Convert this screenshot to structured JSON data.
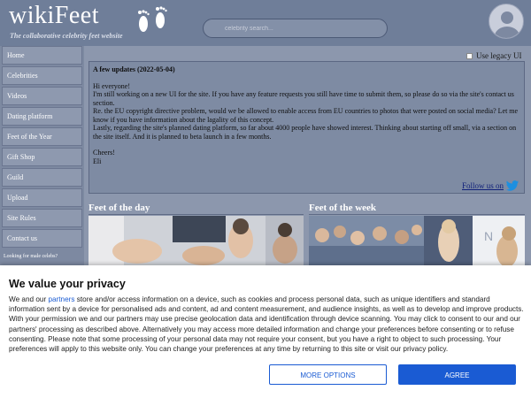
{
  "header": {
    "logo": "wikiFeet",
    "tagline": "The collaborative celebrity feet website",
    "search_placeholder": "celebrity search..."
  },
  "sidebar": {
    "items": [
      {
        "label": "Home"
      },
      {
        "label": "Celebrities"
      },
      {
        "label": "Videos"
      },
      {
        "label": "Dating platform"
      },
      {
        "label": "Feet of the Year"
      },
      {
        "label": "Gift Shop"
      },
      {
        "label": "Guild"
      },
      {
        "label": "Upload"
      },
      {
        "label": "Site Rules"
      },
      {
        "label": "Contact us"
      }
    ],
    "note": "Looking for male celebs?"
  },
  "legacy": {
    "label": "Use legacy UI"
  },
  "updates": {
    "title": "A few updates (2022-05-04)",
    "greeting": "Hi everyone!",
    "p1": "I'm still working on a new UI for the site. If you have any feature requests you still have time to submit them, so please do so via the site's contact us section.",
    "p2": "Re. the EU copyright directive problem, would we be allowed to enable access from EU countries to photos that were posted on social media? Let me know if you have information about the lagality of this concept.",
    "p3": "Lastly, regarding the site's planned dating platform, so far about 4000 people have showed interest. Thinking about starting off small, via a section on the site itself. And it is planned to beta launch in a few months.",
    "signoff": "Cheers!",
    "signature": "Eli",
    "follow": "Follow us on"
  },
  "sections": {
    "day": "Feet of the day",
    "week": "Feet of the week"
  },
  "privacy": {
    "title": "We value your privacy",
    "body_pre": "We and our ",
    "partners": "partners",
    "body_post": " store and/or access information on a device, such as cookies and process personal data, such as unique identifiers and standard information sent by a device for personalised ads and content, ad and content measurement, and audience insights, as well as to develop and improve products. With your permission we and our partners may use precise geolocation data and identification through device scanning. You may click to consent to our and our partners' processing as described above. Alternatively you may access more detailed information and change your preferences before consenting or to refuse consenting. Please note that some processing of your personal data may not require your consent, but you have a right to object to such processing. Your preferences will apply to this website only. You can change your preferences at any time by returning to this site or visit our privacy policy.",
    "more_options": "MORE OPTIONS",
    "agree": "AGREE"
  }
}
